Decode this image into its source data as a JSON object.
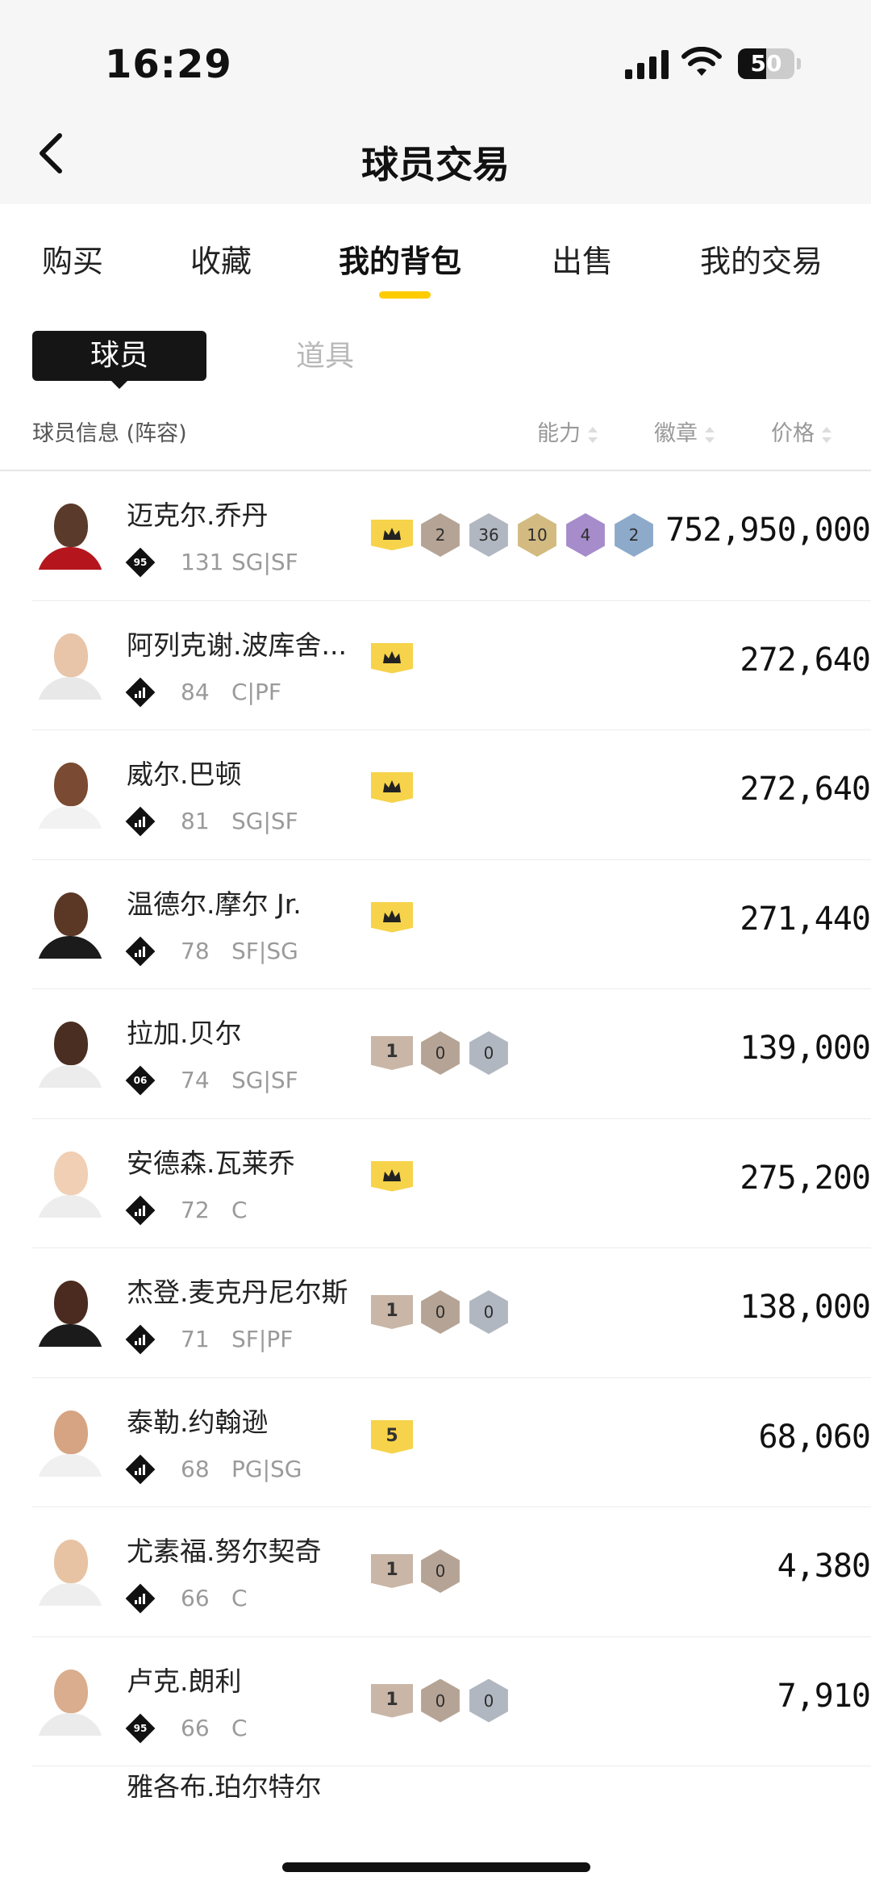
{
  "status": {
    "time": "16:29",
    "battery": "50",
    "battery_level": 0.5
  },
  "header": {
    "title": "球员交易"
  },
  "tabs": [
    {
      "label": "购买"
    },
    {
      "label": "收藏"
    },
    {
      "label": "我的背包"
    },
    {
      "label": "出售"
    },
    {
      "label": "我的交易"
    }
  ],
  "active_tab": "我的背包",
  "sub_tabs": {
    "active": "球员",
    "other": "道具"
  },
  "columns": {
    "info": "球员信息 (阵容)",
    "ability": "能力",
    "badge": "徽章",
    "price": "价格"
  },
  "colors": {
    "accent": "#ffcc00",
    "crown": "#f6d34a",
    "bronze": "#c9b6a6",
    "silver": "#c5cbd5",
    "gold": "#e9cf8f",
    "purple": "#b99be0",
    "blue": "#9dbde0"
  },
  "players": [
    {
      "name": "迈克尔.乔丹",
      "tag": "95",
      "rating": "131",
      "pos": "SG|SF",
      "price": "752,950,000",
      "badges": [
        {
          "type": "crown"
        },
        {
          "type": "hex",
          "value": "2",
          "color": "bronze"
        },
        {
          "type": "hex",
          "value": "36",
          "color": "silver"
        },
        {
          "type": "hex",
          "value": "10",
          "color": "gold"
        },
        {
          "type": "hex",
          "value": "4",
          "color": "purple"
        },
        {
          "type": "hex",
          "value": "2",
          "color": "blue"
        }
      ]
    },
    {
      "name": "阿列克谢.波库舍...",
      "tag": "bars",
      "rating": "84",
      "pos": "C|PF",
      "price": "272,640",
      "badges": [
        {
          "type": "crown"
        }
      ]
    },
    {
      "name": "威尔.巴顿",
      "tag": "bars",
      "rating": "81",
      "pos": "SG|SF",
      "price": "272,640",
      "badges": [
        {
          "type": "crown"
        }
      ]
    },
    {
      "name": "温德尔.摩尔 Jr.",
      "tag": "bars",
      "rating": "78",
      "pos": "SF|SG",
      "price": "271,440",
      "badges": [
        {
          "type": "crown"
        }
      ]
    },
    {
      "name": "拉加.贝尔",
      "tag": "06",
      "rating": "74",
      "pos": "SG|SF",
      "price": "139,000",
      "badges": [
        {
          "type": "shield",
          "value": "1"
        },
        {
          "type": "hex",
          "value": "0",
          "color": "bronze"
        },
        {
          "type": "hex",
          "value": "0",
          "color": "silver"
        }
      ]
    },
    {
      "name": "安德森.瓦莱乔",
      "tag": "bars",
      "rating": "72",
      "pos": "C",
      "price": "275,200",
      "badges": [
        {
          "type": "crown"
        }
      ]
    },
    {
      "name": "杰登.麦克丹尼尔斯",
      "tag": "bars",
      "rating": "71",
      "pos": "SF|PF",
      "price": "138,000",
      "badges": [
        {
          "type": "shield",
          "value": "1"
        },
        {
          "type": "hex",
          "value": "0",
          "color": "bronze"
        },
        {
          "type": "hex",
          "value": "0",
          "color": "silver"
        }
      ]
    },
    {
      "name": "泰勒.约翰逊",
      "tag": "bars",
      "rating": "68",
      "pos": "PG|SG",
      "price": "68,060",
      "badges": [
        {
          "type": "shield5",
          "value": "5"
        }
      ]
    },
    {
      "name": "尤素福.努尔契奇",
      "tag": "bars",
      "rating": "66",
      "pos": "C",
      "price": "4,380",
      "badges": [
        {
          "type": "shield",
          "value": "1"
        },
        {
          "type": "hex",
          "value": "0",
          "color": "bronze"
        }
      ]
    },
    {
      "name": "卢克.朗利",
      "tag": "95",
      "rating": "66",
      "pos": "C",
      "price": "7,910",
      "badges": [
        {
          "type": "shield",
          "value": "1"
        },
        {
          "type": "hex",
          "value": "0",
          "color": "bronze"
        },
        {
          "type": "hex",
          "value": "0",
          "color": "silver"
        }
      ]
    }
  ],
  "partial_player": {
    "name": "雅各布.珀尔特尔"
  }
}
